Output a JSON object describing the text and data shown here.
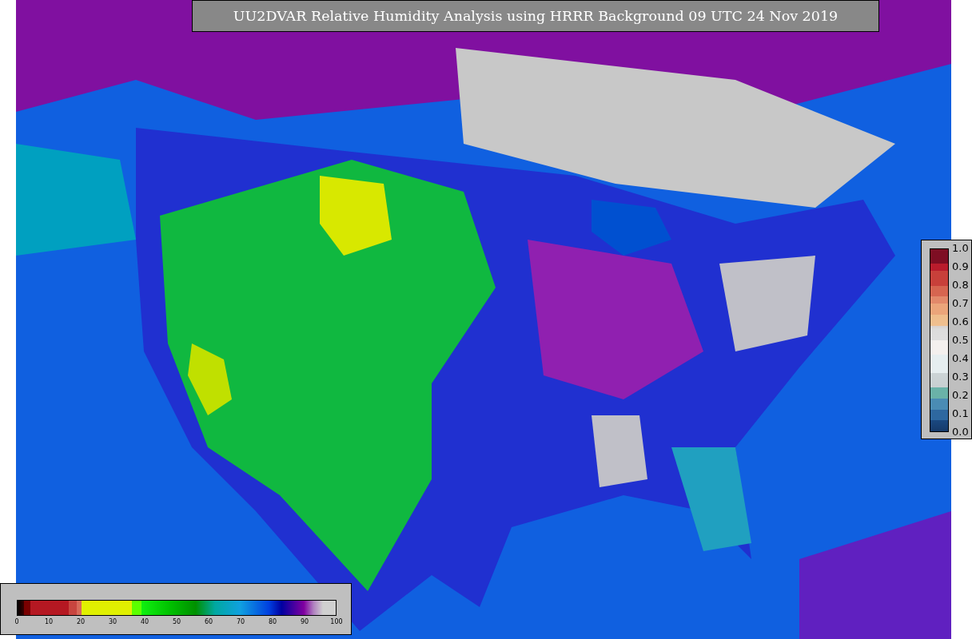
{
  "title": "UU2DVAR Relative Humidity Analysis using HRRR Background 09 UTC 24 Nov 2019",
  "humidity_colorbar": {
    "tick_labels": [
      "0",
      "10",
      "20",
      "30",
      "40",
      "50",
      "60",
      "70",
      "80",
      "90",
      "100"
    ]
  },
  "observation_colorbar": {
    "tick_labels": [
      "1.0",
      "0.9",
      "0.8",
      "0.7",
      "0.6",
      "0.5",
      "0.4",
      "0.3",
      "0.2",
      "0.1",
      "0.0"
    ]
  }
}
